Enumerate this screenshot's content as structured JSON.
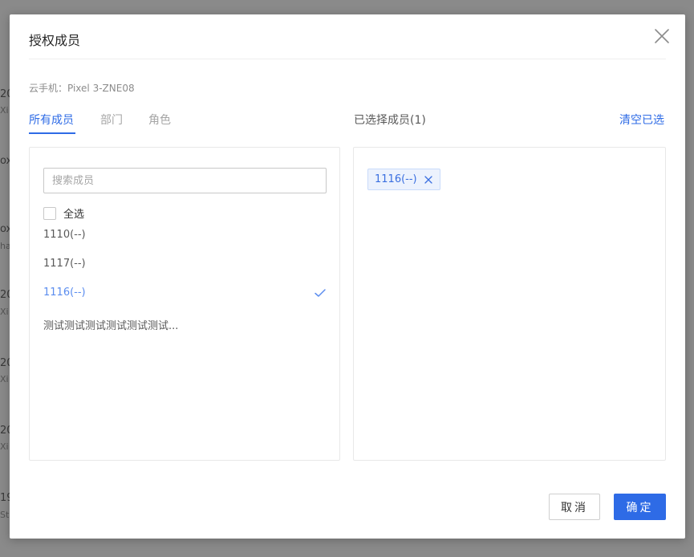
{
  "background_fragments": [
    {
      "text": "20",
      "top": 0
    },
    {
      "text": "Xi",
      "top": 0
    },
    {
      "text": "ox",
      "top": 0
    },
    {
      "text": "ox",
      "top": 0
    },
    {
      "text": "ha",
      "top": 0
    },
    {
      "text": "20",
      "top": 0
    },
    {
      "text": "Xi",
      "top": 0
    },
    {
      "text": "20",
      "top": 0
    },
    {
      "text": "Xi",
      "top": 0
    },
    {
      "text": "20",
      "top": 0
    },
    {
      "text": "Xi",
      "top": 0
    },
    {
      "text": "19",
      "top": 0
    },
    {
      "text": "Sta",
      "top": 0
    }
  ],
  "modal": {
    "title": "授权成员",
    "device_line": "云手机：Pixel 3-ZNE08"
  },
  "tabs": [
    {
      "label": "所有成员",
      "active": true
    },
    {
      "label": "部门",
      "active": false
    },
    {
      "label": "角色",
      "active": false
    }
  ],
  "selected_panel": {
    "title": "已选择成员(1)",
    "clear_label": "清空已选",
    "tags": [
      {
        "label": "1116(--)"
      }
    ]
  },
  "member_panel": {
    "search_placeholder": "搜索成员",
    "select_all_label": "全选",
    "members": [
      {
        "label": "1110(--)",
        "selected": false
      },
      {
        "label": "1117(--)",
        "selected": false
      },
      {
        "label": "1116(--)",
        "selected": true
      },
      {
        "label": "测试测试测试测试测试测试...",
        "selected": false
      }
    ]
  },
  "footer": {
    "cancel_label": "取消",
    "ok_label": "确定"
  },
  "colors": {
    "accent": "#2e6be6",
    "selected_text": "#5b8def",
    "overlay_bg": "#8a8a8a"
  }
}
